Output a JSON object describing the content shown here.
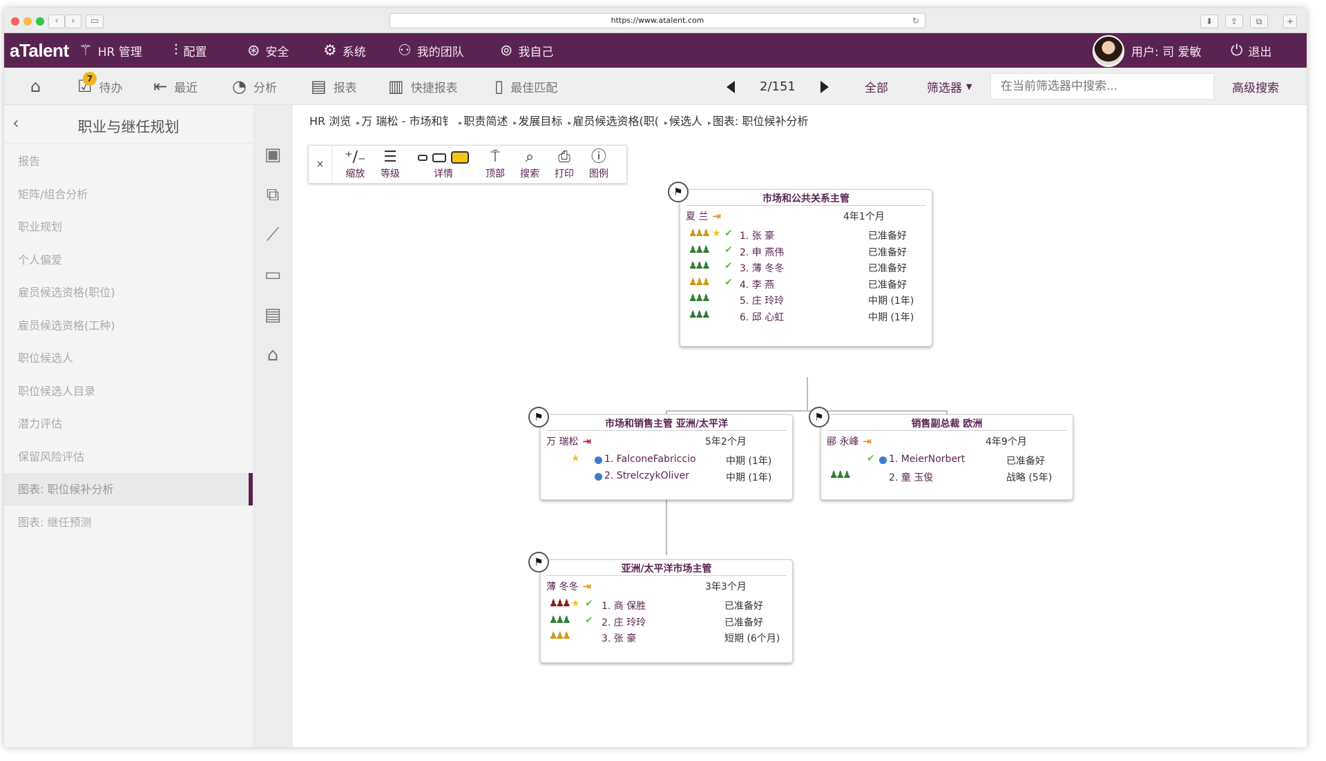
{
  "browser": {
    "url": "https://www.atalent.com"
  },
  "app": {
    "brand": "aTalent",
    "menu": [
      "HR 管理",
      "配置",
      "安全",
      "系统",
      "我的团队",
      "我自己"
    ],
    "user_label": "用户: 司 爱敏",
    "logout_label": "退出"
  },
  "toolbar": {
    "items": [
      "待办",
      "最近",
      "分析",
      "报表",
      "快捷报表",
      "最佳匹配"
    ],
    "todo_badge": "7",
    "pager": "2/151",
    "filter_all": "全部",
    "filter_label": "筛选器",
    "search_placeholder": "在当前筛选器中搜索...",
    "advanced_search": "高级搜索"
  },
  "sidebar": {
    "title": "职业与继任规划",
    "items": [
      "报告",
      "矩阵/组合分析",
      "职业规划",
      "个人偏爱",
      "雇员候选资格(职位)",
      "雇员候选资格(工种)",
      "职位候选人",
      "职位候选人目录",
      "潜力评估",
      "保留风险评估",
      "图表: 职位候补分析",
      "图表: 继任预测"
    ],
    "active_index": 10
  },
  "breadcrumb": [
    "HR 浏览",
    "万 瑞松 - 市场和钅",
    "职责简述",
    "发展目标",
    "雇员候选资格(职(",
    "候选人",
    "图表: 职位候补分析"
  ],
  "chart_tools": {
    "close": "×",
    "buttons": [
      "缩放",
      "等级",
      "详情",
      "顶部",
      "搜索",
      "打印",
      "图例"
    ]
  },
  "colors": {
    "brand": "#5a2350",
    "ready_green": "#2e7d32",
    "amber": "#c89a16",
    "red": "#8b1a1a",
    "dot_blue": "#3a7ecb"
  },
  "org_chart": {
    "top": {
      "title": "市场和公共关系主管",
      "holder": "夏 兰",
      "tenure": "4年1个月",
      "candidates": [
        {
          "name": "1. 张 豪",
          "status": "已准备好",
          "people_color": "#c89a16",
          "star": true,
          "check": true
        },
        {
          "name": "2. 申 燕伟",
          "status": "已准备好",
          "people_color": "#2e7d32",
          "star": false,
          "check": true
        },
        {
          "name": "3. 薄 冬冬",
          "status": "已准备好",
          "people_color": "#2e7d32",
          "star": false,
          "check": true
        },
        {
          "name": "4. 李 燕",
          "status": "已准备好",
          "people_color": "#c89a16",
          "star": false,
          "check": true
        },
        {
          "name": "5. 庄 玲玲",
          "status": "中期 (1年)",
          "people_color": "#2e7d32",
          "star": false,
          "check": false
        },
        {
          "name": "6. 邱 心虹",
          "status": "中期 (1年)",
          "people_color": "#2e7d32",
          "star": false,
          "check": false
        }
      ]
    },
    "left": {
      "title": "市场和销售主管 亚洲/太平洋",
      "holder": "万 瑞松",
      "tenure": "5年2个月",
      "candidates": [
        {
          "name": "1. FalconeFabriccio",
          "status": "中期 (1年)",
          "star": true,
          "bullet": true
        },
        {
          "name": "2. StrelczykOliver",
          "status": "中期 (1年)",
          "star": false,
          "bullet": true
        }
      ]
    },
    "right": {
      "title": "销售副总裁 欧洲",
      "holder": "郦 永峰",
      "tenure": "4年9个月",
      "candidates": [
        {
          "name": "1. MeierNorbert",
          "status": "已准备好",
          "check": true,
          "bullet": true
        },
        {
          "name": "2. 童 玉俊",
          "status": "战略 (5年)",
          "people_color": "#2e7d32"
        }
      ]
    },
    "bottom": {
      "title": "亚洲/太平洋市场主管",
      "holder": "薄 冬冬",
      "tenure": "3年3个月",
      "candidates": [
        {
          "name": "1. 商 保胜",
          "status": "已准备好",
          "people_color": "#8b1a1a",
          "star": true,
          "check": true
        },
        {
          "name": "2. 庄 玲玲",
          "status": "已准备好",
          "people_color": "#2e7d32",
          "check": true
        },
        {
          "name": "3. 张 豪",
          "status": "短期 (6个月)",
          "people_color": "#c89a16"
        }
      ]
    }
  }
}
